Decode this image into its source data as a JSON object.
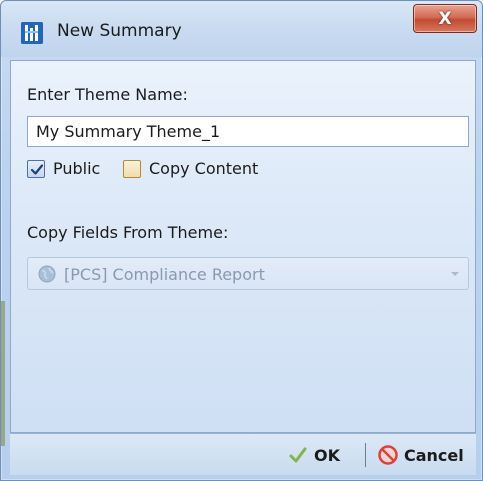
{
  "window": {
    "title": "New Summary",
    "close_glyph": "X"
  },
  "form": {
    "theme_name_label": "Enter Theme Name:",
    "theme_name_value": "My Summary Theme_1",
    "public_label": "Public",
    "public_checked": true,
    "copy_content_label": "Copy Content",
    "copy_content_checked": false,
    "copy_fields_label": "Copy Fields From Theme:",
    "copy_fields_value": "[PCS] Compliance Report",
    "copy_fields_icon": "globe-icon",
    "copy_fields_enabled": false
  },
  "footer": {
    "ok_label": "OK",
    "ok_icon": "check-icon",
    "cancel_label": "Cancel",
    "cancel_icon": "no-entry-icon"
  },
  "colors": {
    "close_button": "#c24b33",
    "ok_check": "#7fb84a",
    "cancel_icon": "#d8443c"
  }
}
